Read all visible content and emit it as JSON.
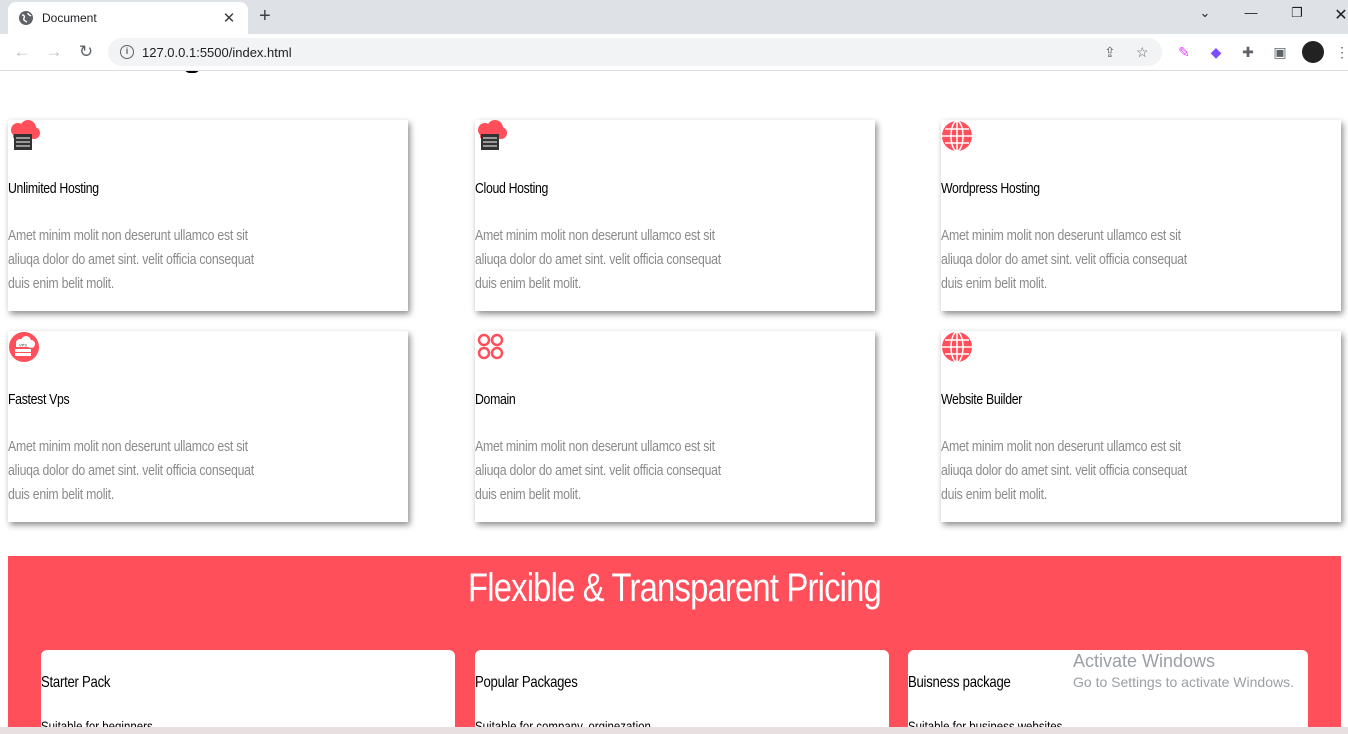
{
  "browser": {
    "tab_title": "Document",
    "url": "127.0.0.1:5500/index.html",
    "new_tab": "+",
    "close_tab": "✕"
  },
  "services": [
    {
      "title": "Unlimited Hosting",
      "desc": "Amet minim molit non deserunt ullamco est sit aliuqa dolor do amet sint. velit officia consequat duis enim belit molit.",
      "icon": "cloud-server-icon"
    },
    {
      "title": "Cloud Hosting",
      "desc": "Amet minim molit non deserunt ullamco est sit aliuqa dolor do amet sint. velit officia consequat duis enim belit molit.",
      "icon": "cloud-server-icon"
    },
    {
      "title": "Wordpress Hosting",
      "desc": "Amet minim molit non deserunt ullamco est sit aliuqa dolor do amet sint. velit officia consequat duis enim belit molit.",
      "icon": "globe-icon"
    },
    {
      "title": "Fastest Vps",
      "desc": "Amet minim molit non deserunt ullamco est sit aliuqa dolor do amet sint. velit officia consequat duis enim belit molit.",
      "icon": "vps-icon"
    },
    {
      "title": "Domain",
      "desc": "Amet minim molit non deserunt ullamco est sit aliuqa dolor do amet sint. velit officia consequat duis enim belit molit.",
      "icon": "four-circles-icon"
    },
    {
      "title": "Website Builder",
      "desc": "Amet minim molit non deserunt ullamco est sit aliuqa dolor do amet sint. velit officia consequat duis enim belit molit.",
      "icon": "globe-icon"
    }
  ],
  "pricing": {
    "heading": "Flexible & Transparent Pricing",
    "plans": [
      {
        "name": "Starter Pack",
        "sub": "Suitable for beginners"
      },
      {
        "name": "Popular Packages",
        "sub": "Suitable for company, orginezation"
      },
      {
        "name": "Buisness package",
        "sub": "Suitable for business websites"
      }
    ]
  },
  "watermark": {
    "line1": "Activate Windows",
    "line2": "Go to Settings to activate Windows."
  },
  "colors": {
    "accent": "#ff4f5a"
  }
}
